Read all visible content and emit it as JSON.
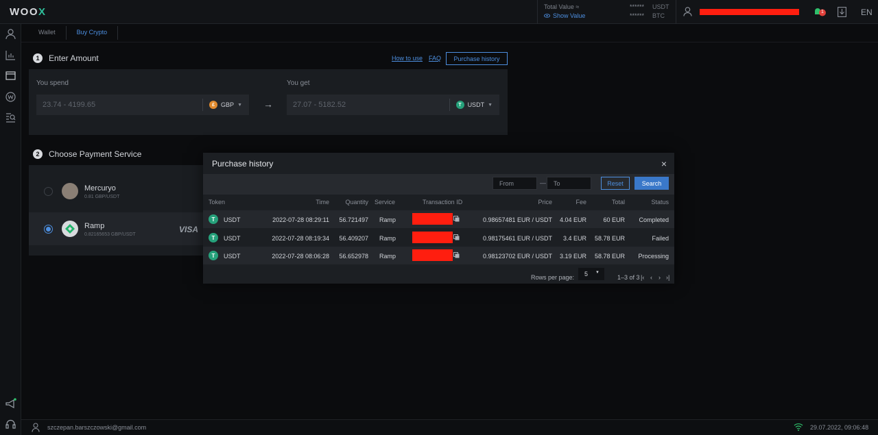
{
  "brand": {
    "logo_main": "WOO",
    "logo_x": "X"
  },
  "topbar": {
    "total_value_label": "Total Value ≈",
    "show_value_label": "Show Value",
    "balances": [
      {
        "masked": "******",
        "currency": "USDT"
      },
      {
        "masked": "******",
        "currency": "BTC"
      }
    ],
    "notification_count": "1",
    "language": "EN"
  },
  "tabs": [
    {
      "label": "Wallet"
    },
    {
      "label": "Buy Crypto"
    }
  ],
  "step1": {
    "number": "1",
    "title": "Enter Amount",
    "links": {
      "how_to_use": "How to use",
      "faq": "FAQ"
    },
    "purchase_history_button": "Purchase history",
    "spend": {
      "label": "You spend",
      "placeholder": "23.74 - 4199.65",
      "currency": "GBP"
    },
    "get": {
      "label": "You get",
      "placeholder": "27.07 - 5182.52",
      "currency": "USDT"
    }
  },
  "step2": {
    "number": "2",
    "title": "Choose Payment Service",
    "services": [
      {
        "name": "Mercuryo",
        "rate": "0.81 GBP/USDT",
        "selected": false
      },
      {
        "name": "Ramp",
        "rate": "0.82165653 GBP/USDT",
        "selected": true,
        "card": "VISA"
      }
    ]
  },
  "modal": {
    "title": "Purchase history",
    "filter": {
      "from_placeholder": "From",
      "separator": "—",
      "to_placeholder": "To",
      "reset_label": "Reset",
      "search_label": "Search"
    },
    "columns": [
      "Token",
      "Time",
      "Quantity",
      "Service",
      "Transaction ID",
      "Price",
      "Fee",
      "Total",
      "Status"
    ],
    "rows": [
      {
        "token": "USDT",
        "time": "2022-07-28 08:29:11",
        "quantity": "56.721497",
        "service": "Ramp",
        "price": "0.98657481 EUR / USDT",
        "fee": "4.04 EUR",
        "total": "60 EUR",
        "status": "Completed"
      },
      {
        "token": "USDT",
        "time": "2022-07-28 08:19:34",
        "quantity": "56.409207",
        "service": "Ramp",
        "price": "0.98175461 EUR / USDT",
        "fee": "3.4 EUR",
        "total": "58.78 EUR",
        "status": "Failed"
      },
      {
        "token": "USDT",
        "time": "2022-07-28 08:06:28",
        "quantity": "56.652978",
        "service": "Ramp",
        "price": "0.98123702 EUR / USDT",
        "fee": "3.19 EUR",
        "total": "58.78 EUR",
        "status": "Processing"
      }
    ],
    "pagination": {
      "rows_per_page_label": "Rows per page:",
      "rows_per_page_value": "5",
      "range": "1–3 of 3"
    }
  },
  "footer": {
    "email": "szczepan.barszczowski@gmail.com",
    "datetime": "29.07.2022, 09:06:48"
  },
  "colors": {
    "accent": "#4d8fe0",
    "tether": "#26a17b",
    "redaction": "#ff1e0f",
    "gbp": "#e08a2e"
  }
}
